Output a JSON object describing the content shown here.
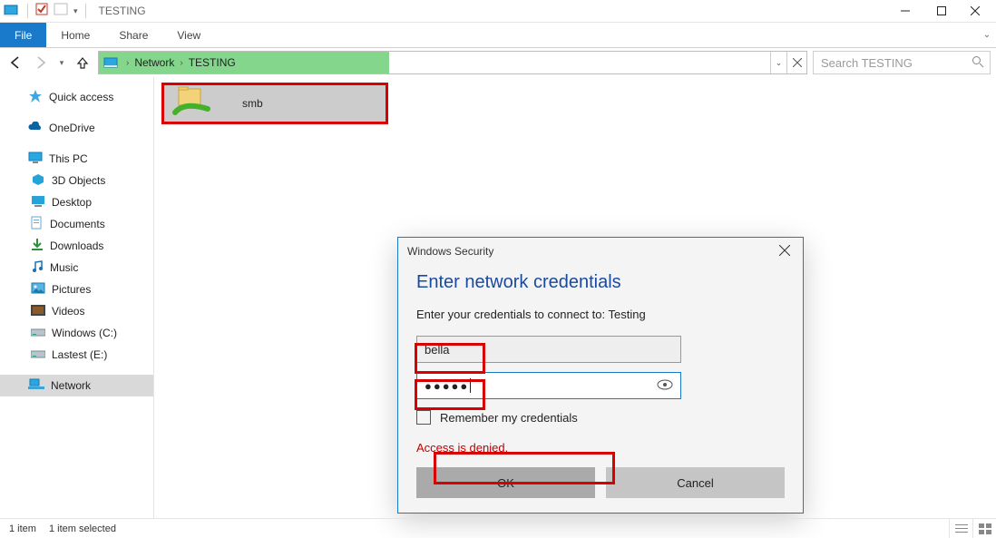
{
  "window": {
    "title": "TESTING",
    "qat_check": true
  },
  "ribbon": {
    "file": "File",
    "home": "Home",
    "share": "Share",
    "view": "View"
  },
  "address": {
    "root": "Network",
    "location": "TESTING"
  },
  "search": {
    "placeholder": "Search TESTING"
  },
  "tree": {
    "quick_access": "Quick access",
    "onedrive": "OneDrive",
    "this_pc": "This PC",
    "objects3d": "3D Objects",
    "desktop": "Desktop",
    "documents": "Documents",
    "downloads": "Downloads",
    "music": "Music",
    "pictures": "Pictures",
    "videos": "Videos",
    "drive_c": "Windows (C:)",
    "drive_e": "Lastest (E:)",
    "network": "Network"
  },
  "share_item": {
    "name": "smb"
  },
  "dialog": {
    "window_title": "Windows Security",
    "heading": "Enter network credentials",
    "prompt": "Enter your credentials to connect to: Testing",
    "username": "bella",
    "password_mask": "●●●●●",
    "remember": "Remember my credentials",
    "error": "Access is denied.",
    "ok": "OK",
    "cancel": "Cancel"
  },
  "status": {
    "count": "1 item",
    "selected": "1 item selected"
  }
}
